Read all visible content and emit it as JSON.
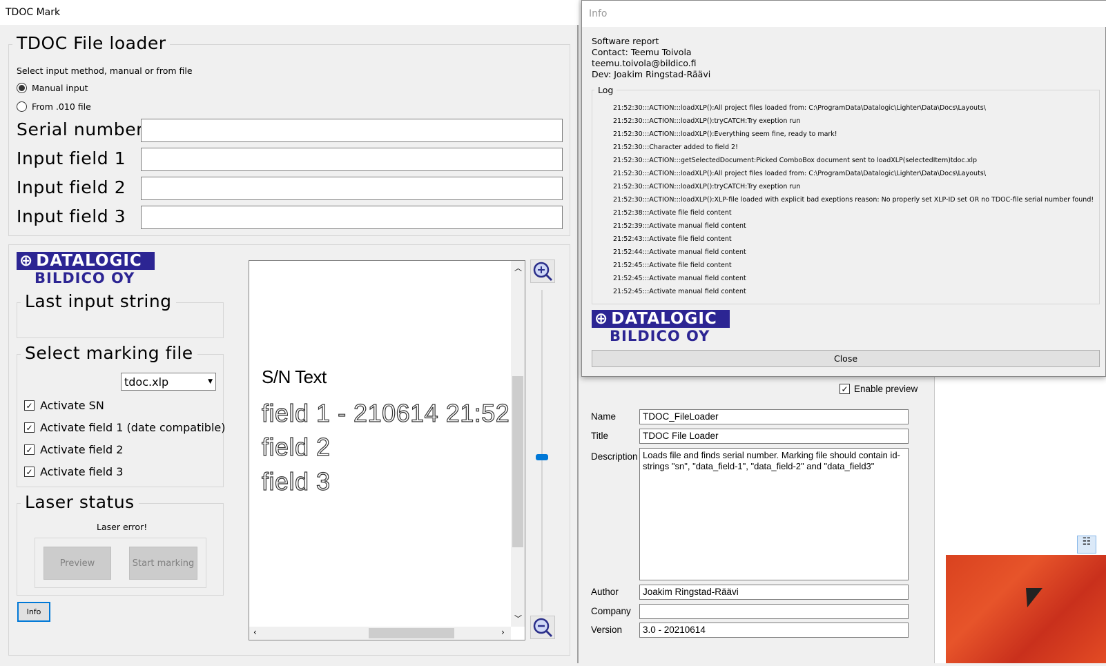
{
  "main_window": {
    "title": "TDOC Mark",
    "file_loader": {
      "group_title": "TDOC File loader",
      "instruction": "Select input method, manual or from file",
      "radio_manual": "Manual input",
      "radio_file": "From .010 file",
      "fields": [
        {
          "label": "Serial number",
          "value": ""
        },
        {
          "label": "Input field 1",
          "value": ""
        },
        {
          "label": "Input field 2",
          "value": ""
        },
        {
          "label": "Input field 3",
          "value": ""
        }
      ]
    },
    "logo": {
      "top": "DATALOGIC",
      "sub": "BILDICO OY"
    },
    "last_input": {
      "title": "Last input string",
      "value": ""
    },
    "marking_file": {
      "title": "Select marking file",
      "selected": "tdoc.xlp",
      "checks": [
        {
          "label": "Activate SN",
          "checked": true
        },
        {
          "label": "Activate field 1 (date compatible)",
          "checked": true
        },
        {
          "label": "Activate field 2",
          "checked": true
        },
        {
          "label": "Activate field 3",
          "checked": true
        }
      ]
    },
    "laser_status": {
      "title": "Laser status",
      "status": "Laser error!",
      "preview_button": "Preview",
      "start_button": "Start marking"
    },
    "info_button": "Info",
    "preview": {
      "sn_text": "S/N Text",
      "field1": "field 1 - 210614 21:52",
      "field2": "field 2",
      "field3": "field 3"
    }
  },
  "info_dialog": {
    "title": "Info",
    "lines": [
      "Software report",
      "Contact: Teemu Toivola",
      "teemu.toivola@bildico.fi",
      "Dev: Joakim Ringstad-Räävi"
    ],
    "log_title": "Log",
    "log": [
      "21:52:30:::ACTION:::loadXLP():All project files loaded from: C:\\ProgramData\\Datalogic\\Lighter\\Data\\Docs\\Layouts\\",
      "21:52:30:::ACTION:::loadXLP():tryCATCH:Try exeption run",
      "21:52:30:::ACTION:::loadXLP():Everything seem fine, ready to mark!",
      "21:52:30:::Character added to field 2!",
      "21:52:30:::ACTION:::getSelectedDocument:Picked ComboBox document sent to loadXLP(selectedItem)tdoc.xlp",
      "21:52:30:::ACTION:::loadXLP():All project files loaded from: C:\\ProgramData\\Datalogic\\Lighter\\Data\\Docs\\Layouts\\",
      "21:52:30:::ACTION:::loadXLP():tryCATCH:Try exeption run",
      "21:52:30:::ACTION:::loadXLP():XLP-file loaded with explicit bad exeptions reason: No properly set XLP-ID set OR no TDOC-file serial number found!",
      "21:52:38:::Activate file field content",
      "21:52:39:::Activate manual field content",
      "21:52:43:::Activate file field content",
      "21:52:44:::Activate manual field content",
      "21:52:45:::Activate file field content",
      "21:52:45:::Activate manual field content",
      "21:52:45:::Activate manual field content"
    ],
    "close_button": "Close"
  },
  "properties": {
    "enable_preview": "Enable preview",
    "name_label": "Name",
    "name_value": "TDOC_FileLoader",
    "title_label": "Title",
    "title_value": "TDOC File Loader",
    "description_label": "Description",
    "description_value": "Loads file and finds serial number. Marking file should contain id-strings \"sn\", \"data_field-1\", \"data_field-2\" and \"data_field3\"",
    "author_label": "Author",
    "author_value": "Joakim Ringstad-Räävi",
    "company_label": "Company",
    "company_value": "",
    "version_label": "Version",
    "version_value": "3.0 - 20210614"
  }
}
